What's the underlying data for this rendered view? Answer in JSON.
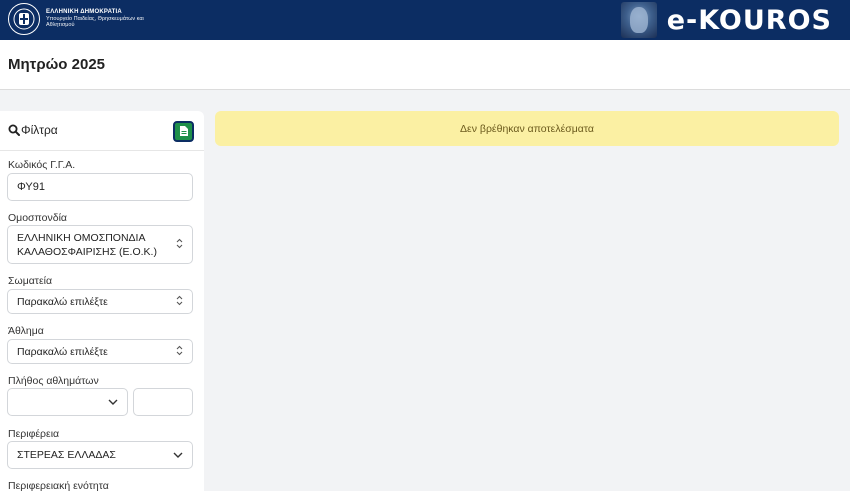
{
  "header": {
    "gov_title": "ΕΛΛΗΝΙΚΗ ΔΗΜΟΚΡΑΤΙΑ",
    "gov_subtitle": "Υπουργείο Παιδείας, Θρησκευμάτων και Αθλητισμού",
    "brand_name": "e-KOUROS",
    "bar_color": "#0c2d63"
  },
  "page": {
    "title": "Μητρώο 2025"
  },
  "filters": {
    "heading": "Φίλτρα",
    "export_icon": "file-icon",
    "code": {
      "label": "Κωδικός Γ.Γ.Α.",
      "value": "ΦΥ91"
    },
    "federation": {
      "label": "Ομοσπονδία",
      "value": "ΕΛΛΗΝΙΚΗ ΟΜΟΣΠΟΝΔΙΑ ΚΑΛΑΘΟΣΦΑΙΡΙΣΗΣ (Ε.Ο.Κ.)"
    },
    "clubs": {
      "label": "Σωματεία",
      "value": "Παρακαλώ επιλέξτε"
    },
    "sport": {
      "label": "Άθλημα",
      "value": "Παρακαλώ επιλέξτε"
    },
    "athletes_count": {
      "label": "Πλήθος αθλημάτων",
      "operator_value": "",
      "number_value": ""
    },
    "region": {
      "label": "Περιφέρεια",
      "value": "ΣΤΕΡΕΑΣ ΕΛΛΑΔΑΣ"
    },
    "regional_unit": {
      "label": "Περιφερειακή ενότητα"
    }
  },
  "results": {
    "empty_message": "Δεν βρέθηκαν αποτελέσματα",
    "alert_color": "#fbf0a3"
  }
}
